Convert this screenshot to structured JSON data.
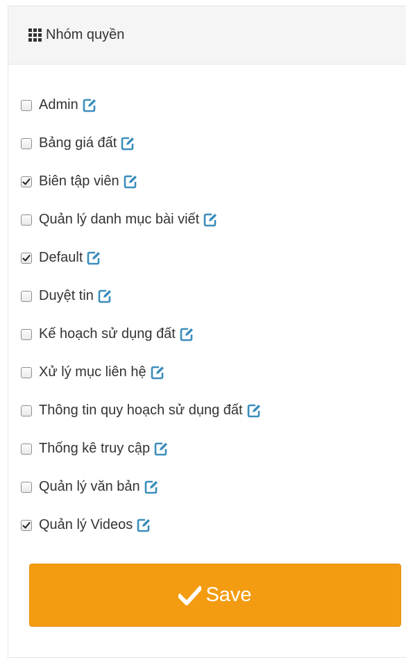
{
  "panel": {
    "title": "Nhóm quyền",
    "icon": "grid-icon"
  },
  "roles": [
    {
      "label": "Admin",
      "checked": false
    },
    {
      "label": "Bảng giá đất",
      "checked": false
    },
    {
      "label": "Biên tập viên",
      "checked": true
    },
    {
      "label": "Quản lý danh mục bài viết",
      "checked": false
    },
    {
      "label": "Default",
      "checked": true
    },
    {
      "label": "Duyệt tin",
      "checked": false
    },
    {
      "label": "Kế hoạch sử dụng đất",
      "checked": false
    },
    {
      "label": "Xử lý mục liên hệ",
      "checked": false
    },
    {
      "label": "Thông tin quy hoạch sử dụng đất",
      "checked": false
    },
    {
      "label": "Thống kê truy cập",
      "checked": false
    },
    {
      "label": "Quản lý văn bản",
      "checked": false
    },
    {
      "label": "Quản lý Videos",
      "checked": true
    }
  ],
  "save_button": {
    "label": "Save",
    "icon": "check-icon"
  },
  "colors": {
    "accent": "#f39c12",
    "edit_icon": "#3c8dbc",
    "header_bg": "#f5f5f5"
  }
}
